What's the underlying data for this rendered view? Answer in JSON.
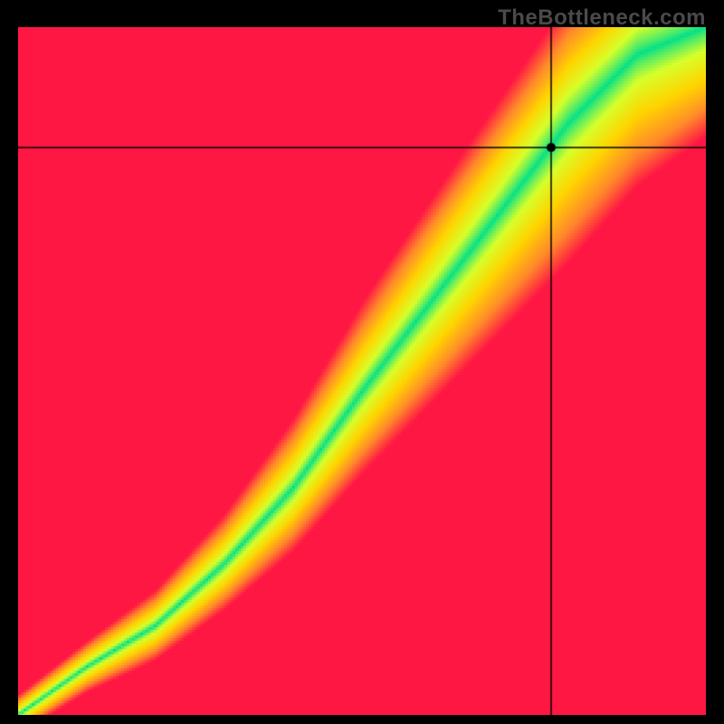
{
  "watermark": "TheBottleneck.com",
  "chart_data": {
    "type": "heatmap",
    "title": "",
    "xlabel": "",
    "ylabel": "",
    "xlim": [
      0,
      1
    ],
    "ylim": [
      0,
      1
    ],
    "marker": {
      "x": 0.775,
      "y": 0.825
    },
    "crosshair": {
      "x": 0.775,
      "y": 0.825
    },
    "ridge": {
      "description": "Green optimal-fit band in CPU/GPU balance space",
      "points": [
        {
          "x": 0.0,
          "y": 0.0
        },
        {
          "x": 0.1,
          "y": 0.07
        },
        {
          "x": 0.2,
          "y": 0.13
        },
        {
          "x": 0.3,
          "y": 0.22
        },
        {
          "x": 0.4,
          "y": 0.33
        },
        {
          "x": 0.5,
          "y": 0.47
        },
        {
          "x": 0.6,
          "y": 0.6
        },
        {
          "x": 0.7,
          "y": 0.73
        },
        {
          "x": 0.8,
          "y": 0.86
        },
        {
          "x": 0.9,
          "y": 0.96
        },
        {
          "x": 1.0,
          "y": 1.0
        }
      ],
      "half_width": [
        0.01,
        0.013,
        0.018,
        0.025,
        0.035,
        0.045,
        0.055,
        0.065,
        0.075,
        0.07,
        0.06
      ]
    },
    "color_scale": {
      "stops": [
        {
          "t": 0.0,
          "color": "#00e08a"
        },
        {
          "t": 0.25,
          "color": "#d7ff2a"
        },
        {
          "t": 0.5,
          "color": "#ffd400"
        },
        {
          "t": 0.75,
          "color": "#ff8a2a"
        },
        {
          "t": 1.0,
          "color": "#ff1744"
        }
      ]
    }
  }
}
